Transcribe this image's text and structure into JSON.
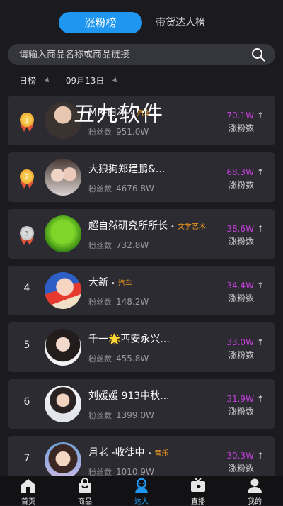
{
  "tabs": [
    {
      "label": "涨粉榜",
      "active": true
    },
    {
      "label": "带货达人榜",
      "active": false
    }
  ],
  "search": {
    "placeholder": "请输入商品名称或商品链接"
  },
  "filters": {
    "period": "日榜",
    "date": "09月13日"
  },
  "watermark": "五九软件",
  "fans_label": "粉丝数",
  "gain_label": "涨粉数",
  "list": [
    {
      "rank": "1",
      "name": "MR-白冰",
      "tag": "汽车",
      "fans": "951.0W",
      "gain": "70.1W"
    },
    {
      "rank": "2",
      "name": "大狼狗郑建鹏&...",
      "tag": "",
      "fans": "4676.8W",
      "gain": "68.3W"
    },
    {
      "rank": "3",
      "name": "超自然研究所所长",
      "tag": "文学艺术",
      "fans": "732.8W",
      "gain": "38.6W"
    },
    {
      "rank": "4",
      "name": "大新",
      "tag": "汽车",
      "fans": "148.2W",
      "gain": "34.4W"
    },
    {
      "rank": "5",
      "name": "千一🌟西安永兴...",
      "tag": "",
      "fans": "455.8W",
      "gain": "33.0W"
    },
    {
      "rank": "6",
      "name": "刘媛媛 913中秋...",
      "tag": "",
      "fans": "1399.0W",
      "gain": "31.9W"
    },
    {
      "rank": "7",
      "name": "月老 -收徒中",
      "tag": "音乐",
      "fans": "1010.9W",
      "gain": "30.3W"
    }
  ],
  "nav": [
    {
      "label": "首页",
      "icon": "home-icon"
    },
    {
      "label": "商品",
      "icon": "bag-icon"
    },
    {
      "label": "达人",
      "icon": "people-icon",
      "active": true
    },
    {
      "label": "直播",
      "icon": "tv-icon"
    },
    {
      "label": "我的",
      "icon": "user-icon"
    }
  ],
  "colors": {
    "accent": "#1f96f0",
    "gain": "#c43fdb",
    "tag": "#f29a1e",
    "card": "#2b2b31",
    "background": "#1a1a1f"
  }
}
